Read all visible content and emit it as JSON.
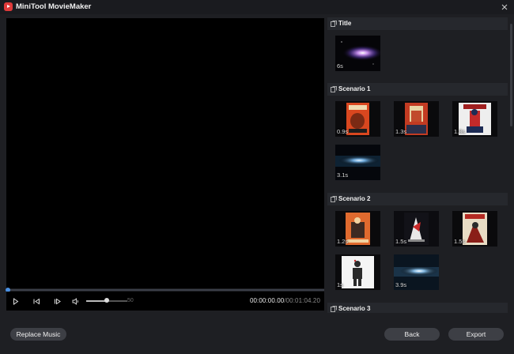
{
  "window": {
    "title": "MiniTool MovieMaker"
  },
  "player": {
    "volume": "50",
    "time_current": "00:00:00.00",
    "time_total": "/00:01:04.20",
    "progress": 0,
    "volume_level": 0.5
  },
  "sections": [
    {
      "title": "Title",
      "clips": [
        {
          "duration": "6s"
        }
      ]
    },
    {
      "title": "Scenario 1",
      "clips": [
        {
          "duration": "0.9s"
        },
        {
          "duration": "1.3s"
        },
        {
          "duration": "1.8s"
        },
        {
          "duration": "3.1s"
        }
      ]
    },
    {
      "title": "Scenario 2",
      "clips": [
        {
          "duration": "1.2s"
        },
        {
          "duration": "1.5s"
        },
        {
          "duration": "1.5s"
        },
        {
          "duration": "1s"
        },
        {
          "duration": "3.9s"
        }
      ]
    },
    {
      "title": "Scenario 3",
      "clips": []
    }
  ],
  "buttons": {
    "replace_music": "Replace Music",
    "back": "Back",
    "export": "Export"
  },
  "colors": {
    "accent": "#4a90e2",
    "app_icon": "#e03a3a",
    "background": "#1e1f23"
  }
}
